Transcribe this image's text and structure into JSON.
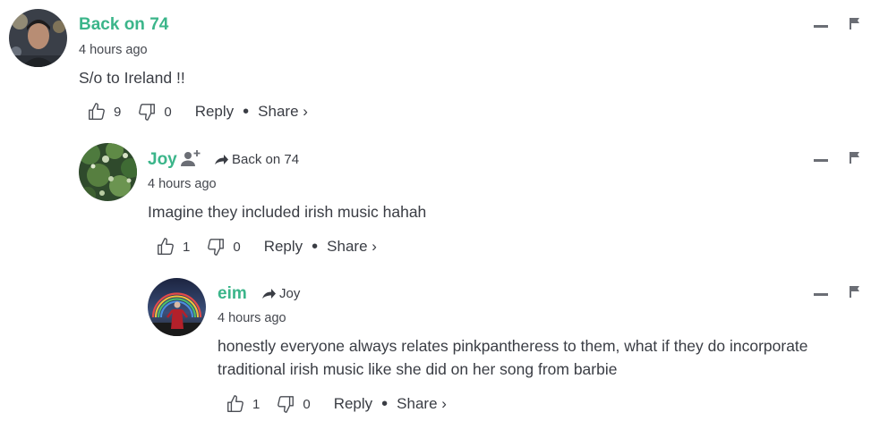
{
  "comments": [
    {
      "author": "Back on 74",
      "time": "4 hours ago",
      "text": "S/o to Ireland !!",
      "likes": "9",
      "dislikes": "0",
      "reply_label": "Reply",
      "share_label": "Share ›"
    },
    {
      "author": "Joy",
      "replying_to": "Back on 74",
      "time": "4 hours ago",
      "text": "Imagine they included irish music hahah",
      "likes": "1",
      "dislikes": "0",
      "reply_label": "Reply",
      "share_label": "Share ›"
    },
    {
      "author": "eim",
      "replying_to": "Joy",
      "time": "4 hours ago",
      "text_lines": [
        "honestly everyone always relates pinkpantheress to them, what if they do incorporate",
        "traditional irish music like she did on her song from barbie"
      ],
      "likes": "1",
      "dislikes": "0",
      "reply_label": "Reply",
      "share_label": "Share ›"
    }
  ],
  "colors": {
    "author": "#3bb58a",
    "text": "#3a3d44",
    "icon": "#6b6e75"
  },
  "icons": [
    "thumbs-up-icon",
    "thumbs-down-icon",
    "add-user-icon",
    "reply-arrow-icon",
    "minimize-icon",
    "flag-icon"
  ]
}
